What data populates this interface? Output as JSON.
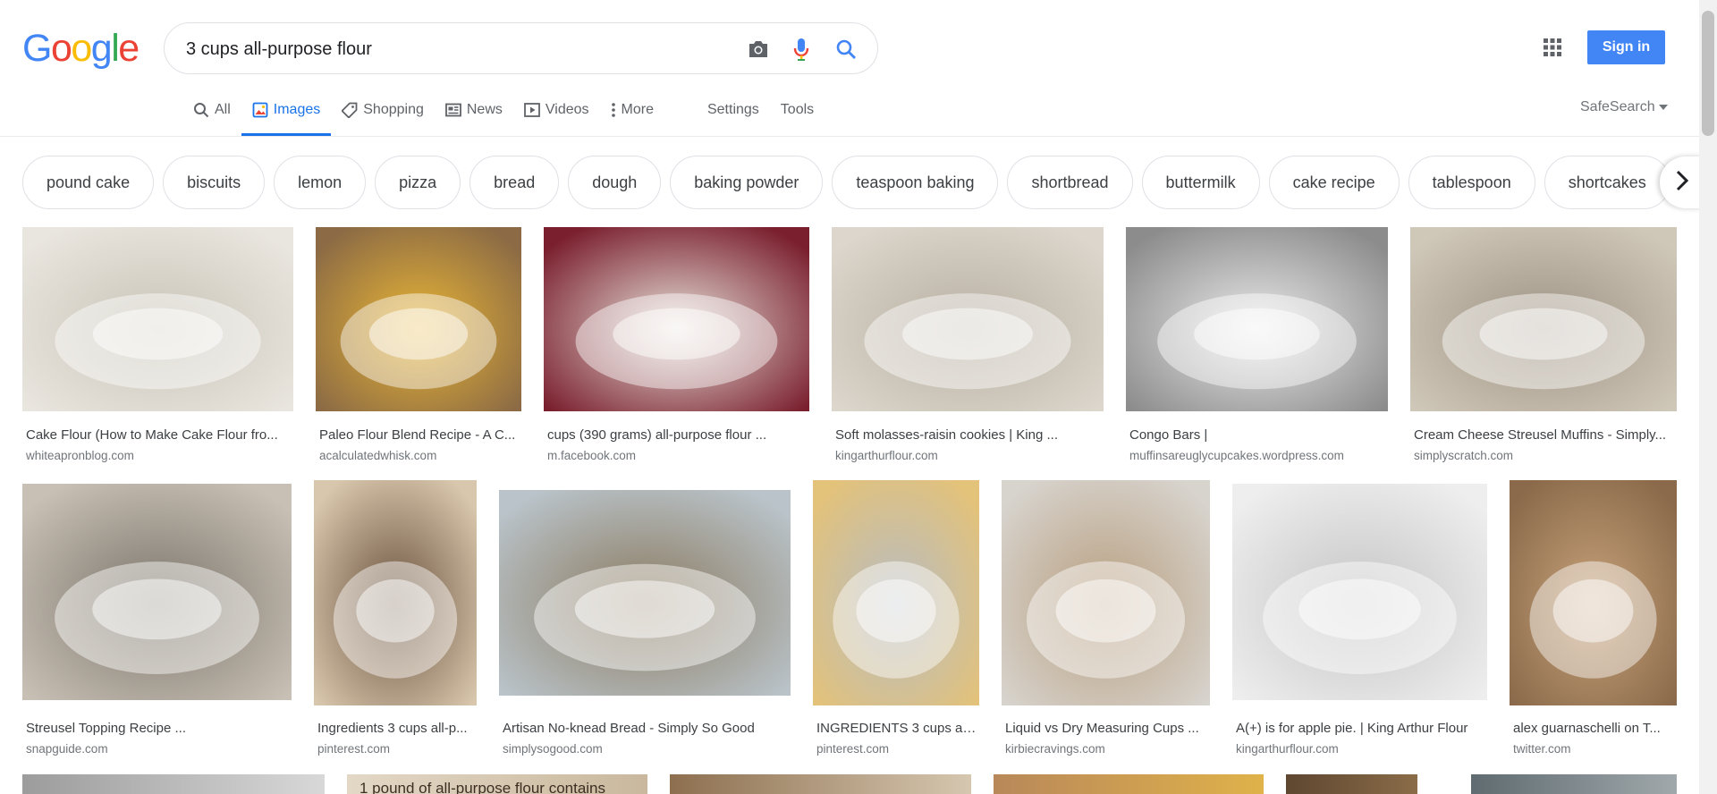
{
  "logo": {
    "text": "Google",
    "letters": [
      "G",
      "o",
      "o",
      "g",
      "l",
      "e"
    ],
    "colors": [
      "#4285f4",
      "#ea4335",
      "#fbbc05",
      "#4285f4",
      "#34a853",
      "#ea4335"
    ]
  },
  "search": {
    "value": "3 cups all-purpose flour",
    "placeholder": ""
  },
  "header": {
    "signin_label": "Sign in",
    "safesearch_label": "SafeSearch"
  },
  "tabs": [
    {
      "label": "All",
      "icon": "search-icon",
      "active": false
    },
    {
      "label": "Images",
      "icon": "image-icon",
      "active": true
    },
    {
      "label": "Shopping",
      "icon": "tag-icon",
      "active": false
    },
    {
      "label": "News",
      "icon": "news-icon",
      "active": false
    },
    {
      "label": "Videos",
      "icon": "video-icon",
      "active": false
    },
    {
      "label": "More",
      "icon": "more-vert-icon",
      "active": false
    }
  ],
  "tools": {
    "settings": "Settings",
    "tools": "Tools"
  },
  "chips": [
    "pound cake",
    "biscuits",
    "lemon",
    "pizza",
    "bread",
    "dough",
    "baking powder",
    "teaspoon baking",
    "shortbread",
    "buttermilk",
    "cake recipe",
    "tablespoon",
    "shortcakes"
  ],
  "results": [
    {
      "caption": "Cake Flour (How to Make Cake Flour fro...",
      "source": "whiteapronblog.com",
      "colors": [
        "#e9e6df",
        "#c9c4b8"
      ]
    },
    {
      "caption": "Paleo Flour Blend Recipe - A C...",
      "source": "acalculatedwhisk.com",
      "colors": [
        "#8b6a45",
        "#e8b535"
      ]
    },
    {
      "caption": "cups (390 grams) all-purpose flour ...",
      "source": "m.facebook.com",
      "colors": [
        "#7a1f2e",
        "#e7e2da"
      ]
    },
    {
      "caption": "Soft molasses-raisin cookies | King ...",
      "source": "kingarthurflour.com",
      "colors": [
        "#dcd6cc",
        "#b8b0a2"
      ]
    },
    {
      "caption": "Congo Bars |",
      "source": "muffinsareuglycupcakes.wordpress.com",
      "colors": [
        "#8c8c8c",
        "#e9e9e9"
      ]
    },
    {
      "caption": "Cream Cheese Streusel Muffins - Simply...",
      "source": "simplyscratch.com",
      "colors": [
        "#cfc7b8",
        "#9f9485"
      ]
    },
    {
      "caption": "Streusel Topping Recipe ...",
      "source": "snapguide.com",
      "colors": [
        "#c8c0b5",
        "#7d766c"
      ]
    },
    {
      "caption": "Ingredients 3 cups all-p...",
      "source": "pinterest.com",
      "colors": [
        "#d9c7ad",
        "#6c5440"
      ]
    },
    {
      "caption": "Artisan No-knead Bread - Simply So Good",
      "source": "simplysogood.com",
      "colors": [
        "#b9c3c9",
        "#8b7a60"
      ]
    },
    {
      "caption": "INGREDIENTS 3 cups all...",
      "source": "pinterest.com",
      "colors": [
        "#e3c27a",
        "#b7bcc2"
      ]
    },
    {
      "caption": "Liquid vs Dry Measuring Cups ...",
      "source": "kirbiecravings.com",
      "colors": [
        "#d7d3cd",
        "#b89f80"
      ]
    },
    {
      "caption": "A(+) is for apple pie. | King Arthur Flour",
      "source": "kingarthurflour.com",
      "colors": [
        "#eeeeee",
        "#c5c5c5"
      ]
    },
    {
      "caption": "alex guarnaschelli on T...",
      "source": "twitter.com",
      "colors": [
        "#8a6a4a",
        "#c7a27a"
      ]
    }
  ],
  "partial_row": [
    {
      "colors": [
        "#9c9c9c",
        "#d8d8d8"
      ]
    },
    {
      "colors": [
        "#e3d8c6",
        "#c9b89d"
      ],
      "text": "1 pound of all-purpose flour contains"
    },
    {
      "colors": [
        "#8d6f4f",
        "#d6c7b0"
      ]
    },
    {
      "colors": [
        "#b8885a",
        "#e0b24a"
      ]
    },
    {
      "colors": [
        "#5e4630",
        "#8a6c48"
      ]
    },
    {
      "colors": [
        "#5f6b70",
        "#a0a8ab"
      ]
    }
  ]
}
